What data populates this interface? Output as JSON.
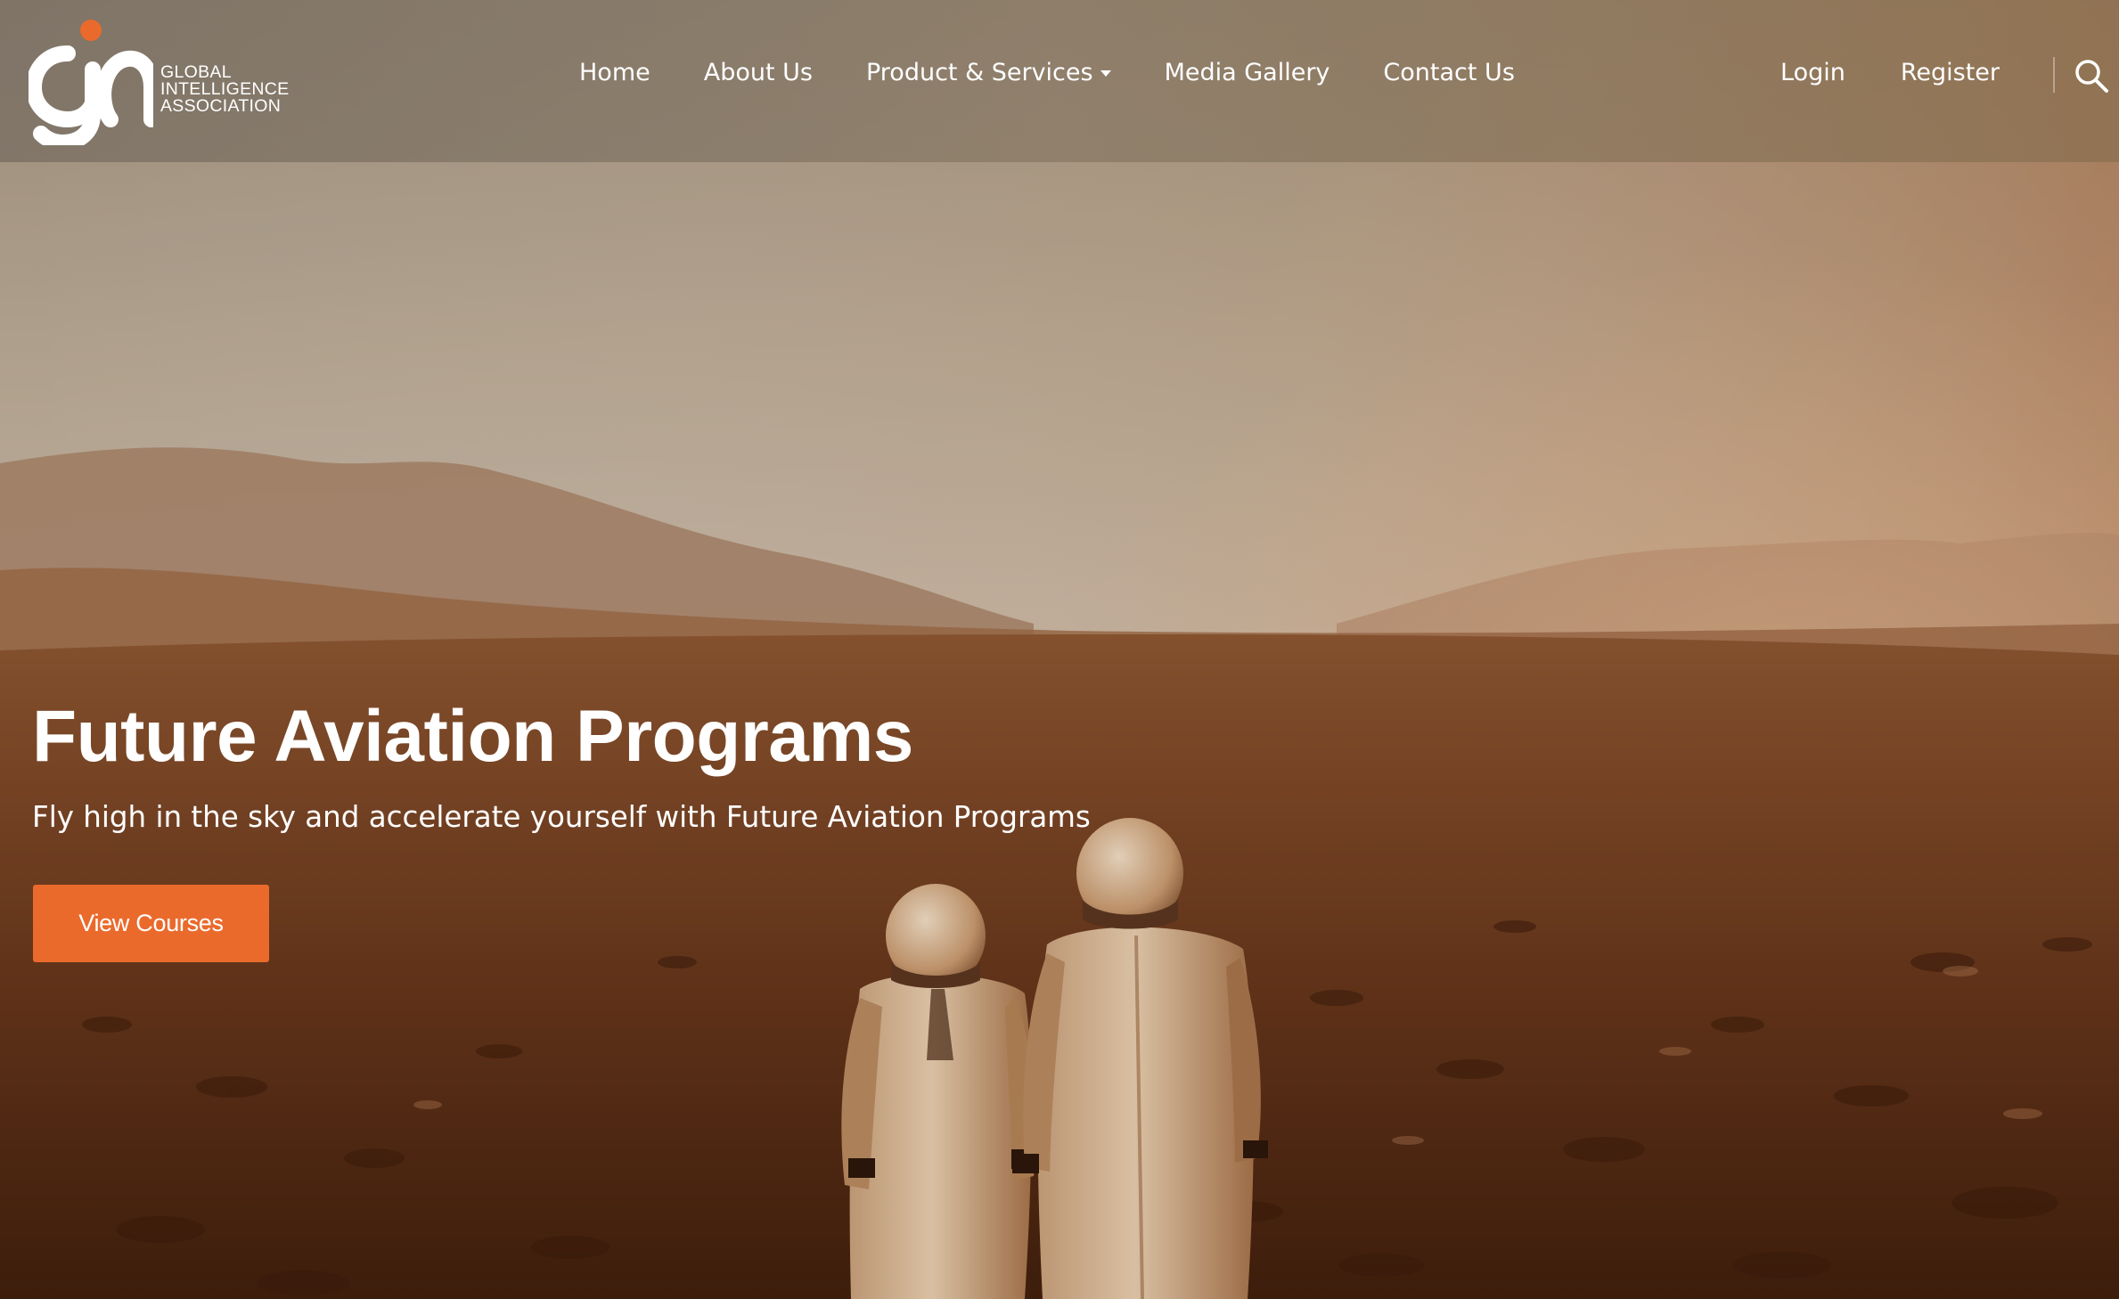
{
  "brand": {
    "name_lines": [
      "GLOBAL",
      "INTELLIGENCE",
      "ASSOCIATION"
    ],
    "accent_color": "#ea6a2c"
  },
  "nav": {
    "items": [
      {
        "label": "Home"
      },
      {
        "label": "About Us"
      },
      {
        "label": "Product & Services",
        "has_dropdown": true
      },
      {
        "label": "Media Gallery"
      },
      {
        "label": "Contact Us"
      }
    ],
    "login_label": "Login",
    "register_label": "Register",
    "search_icon": "search-icon"
  },
  "hero": {
    "title": "Future Aviation Programs",
    "subtitle": "Fly high in the sky and accelerate yourself with Future Aviation Programs",
    "cta_label": "View Courses"
  }
}
